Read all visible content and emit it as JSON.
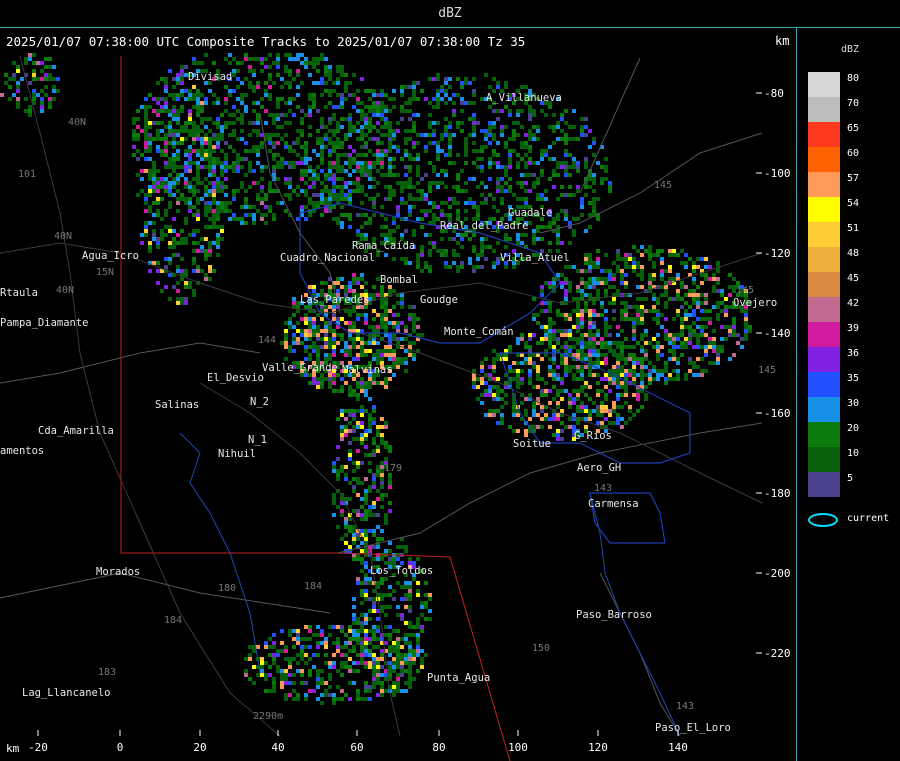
{
  "window": {
    "title": "dBZ"
  },
  "header": {
    "product_line": "2025/01/07 07:38:00 UTC Composite Tracks to 2025/01/07 07:38:00 Tz 35",
    "unit_right": "km",
    "unit_bottom": "km"
  },
  "axes": {
    "y_ticks": [
      "-80",
      "-100",
      "-120",
      "-140",
      "-160",
      "-180",
      "-200",
      "-220"
    ],
    "x_ticks": [
      "-20",
      "0",
      "20",
      "40",
      "60",
      "80",
      "100",
      "120",
      "140"
    ]
  },
  "legend": {
    "unit": "dBZ",
    "levels": [
      {
        "label": "80",
        "color": "#d8d8d8"
      },
      {
        "label": "70",
        "color": "#bdbdbd"
      },
      {
        "label": "65",
        "color": "#ff3a1f"
      },
      {
        "label": "60",
        "color": "#ff6200"
      },
      {
        "label": "57",
        "color": "#ff9a5a"
      },
      {
        "label": "54",
        "color": "#ffff00"
      },
      {
        "label": "51",
        "color": "#ffcc33"
      },
      {
        "label": "48",
        "color": "#f0b040"
      },
      {
        "label": "45",
        "color": "#d88a40"
      },
      {
        "label": "42",
        "color": "#c06a90"
      },
      {
        "label": "39",
        "color": "#d01aa0"
      },
      {
        "label": "36",
        "color": "#8020e0"
      },
      {
        "label": "35",
        "color": "#2050ff"
      },
      {
        "label": "30",
        "color": "#1890e8"
      },
      {
        "label": "20",
        "color": "#0a7a0a"
      },
      {
        "label": "10",
        "color": "#06600a"
      },
      {
        "label": "5",
        "color": "#4a4090"
      }
    ],
    "current_label": "current",
    "current_color": "#00e5ff"
  },
  "places": [
    {
      "name": "Divisad"
    },
    {
      "name": "A_Villanueva"
    },
    {
      "name": "Guadale"
    },
    {
      "name": "Agua_Icro"
    },
    {
      "name": "Rtaula"
    },
    {
      "name": "Pampa_Diamante"
    },
    {
      "name": "El_Desvio"
    },
    {
      "name": "Valle_Grande"
    },
    {
      "name": "Salinas"
    },
    {
      "name": "N_2"
    },
    {
      "name": "N_1"
    },
    {
      "name": "Nihuil"
    },
    {
      "name": "Cda_Amarilla"
    },
    {
      "name": "amentos"
    },
    {
      "name": "Morados"
    },
    {
      "name": "Los_Toldos"
    },
    {
      "name": "Paso_Barroso"
    },
    {
      "name": "Carmensa"
    },
    {
      "name": "Aero_GH"
    },
    {
      "name": "Soitue"
    },
    {
      "name": "G_Rios"
    },
    {
      "name": "Malvinas"
    },
    {
      "name": "Punta_Agua"
    },
    {
      "name": "Lag_Llancanelo"
    },
    {
      "name": "Paso_El_Loro"
    },
    {
      "name": "Ovejero"
    },
    {
      "name": "Bombal"
    },
    {
      "name": "Monte_Comán"
    },
    {
      "name": "Cuadro_Nacional"
    },
    {
      "name": "Las_Paredes"
    },
    {
      "name": "Rama_Caída"
    },
    {
      "name": "Goudge"
    },
    {
      "name": "Real_del_Padre"
    },
    {
      "name": "Villa_Atuel"
    }
  ],
  "route_labels": [
    "40N",
    "101",
    "40N",
    "15N",
    "144",
    "40N",
    "179",
    "184",
    "180",
    "184",
    "183",
    "150",
    "143",
    "143",
    "145",
    "145",
    "145",
    "2290m"
  ]
}
